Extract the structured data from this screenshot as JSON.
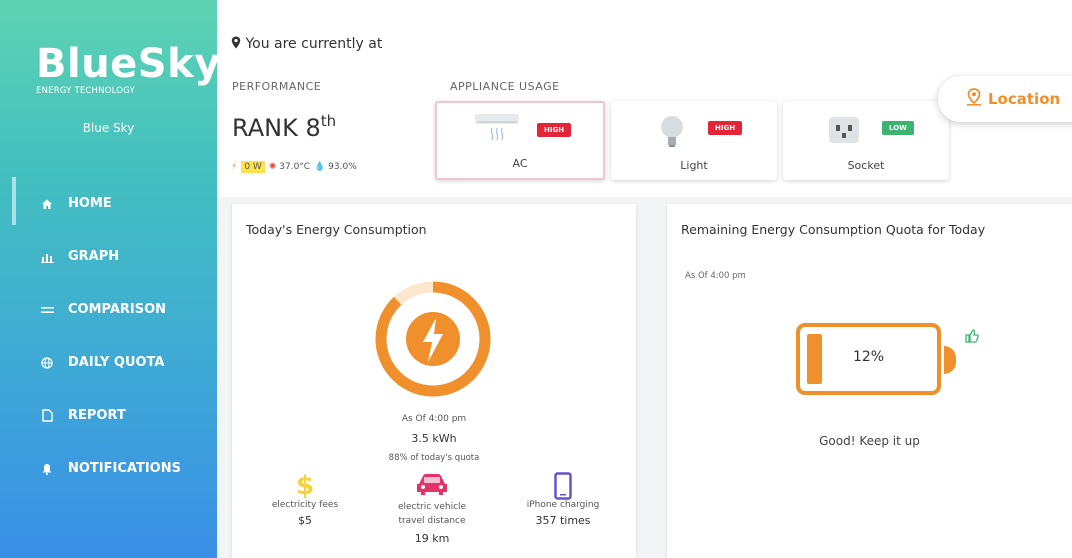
{
  "app": {
    "logo_main": "BlueSky",
    "logo_sub": "ENERGY TECHNOLOGY",
    "user_name": "Blue Sky"
  },
  "nav": [
    {
      "label": "HOME",
      "icon": "home-icon",
      "active": true
    },
    {
      "label": "GRAPH",
      "icon": "bar-chart-icon",
      "active": false
    },
    {
      "label": "COMPARISON",
      "icon": "compare-icon",
      "active": false
    },
    {
      "label": "DAILY QUOTA",
      "icon": "globe-icon",
      "active": false
    },
    {
      "label": "REPORT",
      "icon": "document-icon",
      "active": false
    },
    {
      "label": "NOTIFICATIONS",
      "icon": "bell-icon",
      "active": false
    }
  ],
  "header": {
    "location_text": "You are currently at",
    "performance_label": "PERFORMANCE",
    "rank_text": "RANK 8",
    "rank_suffix": "th",
    "power": "0 W",
    "temperature": "37.0°C",
    "humidity": "93.0%",
    "appliance_label": "APPLIANCE USAGE",
    "location_button": "Location"
  },
  "appliances": [
    {
      "name": "AC",
      "level": "HIGH",
      "icon": "air-conditioner-icon"
    },
    {
      "name": "Light",
      "level": "HIGH",
      "icon": "light-bulb-icon"
    },
    {
      "name": "Socket",
      "level": "LOW",
      "icon": "power-socket-icon"
    }
  ],
  "consumption": {
    "title": "Today's Energy Consumption",
    "as_of": "As Of 4:00 pm",
    "kwh": "3.5 kWh",
    "quota_text": "88% of today's quota",
    "quota_fraction": 0.88,
    "metrics": [
      {
        "label": "electricity fees",
        "value": "$5",
        "icon": "dollar-icon"
      },
      {
        "label": "electric vehicle travel distance",
        "value": "19 km",
        "icon": "car-icon"
      },
      {
        "label": "iPhone charging",
        "value": "357 times",
        "icon": "phone-icon"
      }
    ]
  },
  "quota": {
    "title": "Remaining Energy Consumption Quota for Today",
    "as_of": "As Of 4:00 pm",
    "percent": "12%",
    "fraction": 0.12,
    "message": "Good! Keep it up"
  },
  "colors": {
    "accent": "#f0902c",
    "high": "#e3253a",
    "low": "#3cb371"
  }
}
